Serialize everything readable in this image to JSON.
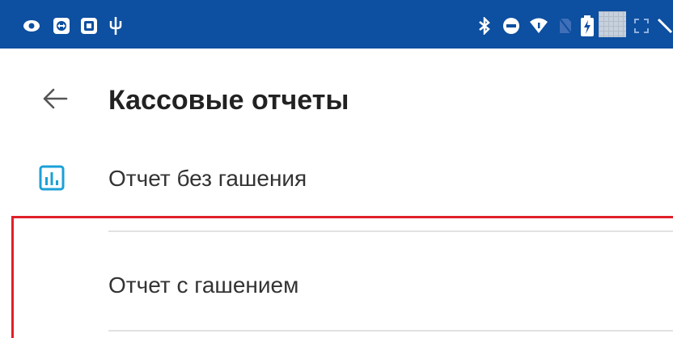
{
  "status_bar": {
    "left_icons": [
      "eye-icon",
      "remote-control-icon",
      "screenshot-icon",
      "usb-icon"
    ],
    "right_icons": [
      "bluetooth-icon",
      "do-not-disturb-icon",
      "wifi-icon",
      "no-sim-icon",
      "battery-icon",
      "expand-icon"
    ],
    "background_color": "#0d4fa0"
  },
  "toolbar": {
    "back_icon": "arrow-left-icon",
    "title": "Кассовые отчеты"
  },
  "menu": {
    "items": [
      {
        "label": "Отчет без гашения",
        "icon": "bar-chart-icon",
        "icon_color": "#1aa0d8"
      },
      {
        "label": "Отчет с гашением",
        "icon": "",
        "highlighted": true
      }
    ],
    "highlight_color": "#e0202a"
  }
}
